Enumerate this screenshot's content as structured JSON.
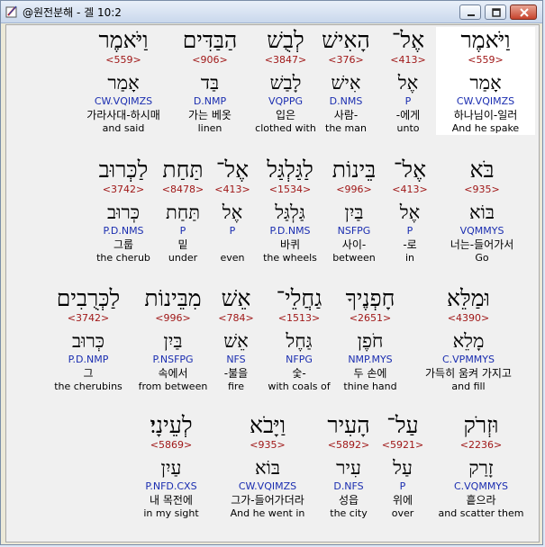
{
  "window": {
    "title": "@원전분해 - 겔 10:2",
    "icon": "bookmark-app-icon"
  },
  "rows": [
    {
      "words": [
        {
          "heb": "וַיֹּאמֶר",
          "strong": "<559>",
          "lex": "אָמַר",
          "morph": "CW.VQIMZS",
          "kor": "하나님이-일러",
          "eng": "And he spake",
          "selected": true
        },
        {
          "heb": "אֶל־",
          "strong": "<413>",
          "lex": "אֶל",
          "morph": "P",
          "kor": "-에게",
          "eng": "unto",
          "selected": false
        },
        {
          "heb": "הָאִישׁ",
          "strong": "<376>",
          "lex": "אִישׁ",
          "morph": "D.NMS",
          "kor": "사람-",
          "eng": "the man",
          "selected": false
        },
        {
          "heb": "לְבֻשׁ",
          "strong": "<3847>",
          "lex": "לָבַשׁ",
          "morph": "VQPPG",
          "kor": "입은",
          "eng": "clothed with",
          "selected": false
        },
        {
          "heb": "הַבַּדִּים",
          "strong": "<906>",
          "lex": "בַּד",
          "morph": "D.NMP",
          "kor": "가는 베옷",
          "eng": "linen",
          "selected": false
        },
        {
          "heb": "וַיֹּאמֶר",
          "strong": "<559>",
          "lex": "אָמַר",
          "morph": "CW.VQIMZS",
          "kor": "가라사대-하시매",
          "eng": "and said",
          "selected": false
        }
      ]
    },
    {
      "words": [
        {
          "heb": "בֹּא",
          "strong": "<935>",
          "lex": "בּוֹא",
          "morph": "VQMMYS",
          "kor": "너는-들어가서",
          "eng": "Go",
          "selected": false
        },
        {
          "heb": "אֶל־",
          "strong": "<413>",
          "lex": "אֶל",
          "morph": "P",
          "kor": "-로",
          "eng": "in",
          "selected": false
        },
        {
          "heb": "בֵּינוֹת",
          "strong": "<996>",
          "lex": "בַּיִן",
          "morph": "NSFPG",
          "kor": "사이-",
          "eng": "between",
          "selected": false
        },
        {
          "heb": "לַגַּלְגַּל",
          "strong": "<1534>",
          "lex": "גַּלְגַּל",
          "morph": "P.D.NMS",
          "kor": "바퀴",
          "eng": "the wheels",
          "selected": false
        },
        {
          "heb": "אֶל־",
          "strong": "<413>",
          "lex": "אֶל",
          "morph": "P",
          "kor": "",
          "eng": "even",
          "selected": false
        },
        {
          "heb": "תַּחַת",
          "strong": "<8478>",
          "lex": "תַּחַת",
          "morph": "P",
          "kor": "밑",
          "eng": "under",
          "selected": false
        },
        {
          "heb": "לַכְּרוּב",
          "strong": "<3742>",
          "lex": "כְּרוּב",
          "morph": "P.D.NMS",
          "kor": "그룹",
          "eng": "the cherub",
          "selected": false
        }
      ]
    },
    {
      "words": [
        {
          "heb": "וּמַלֵּא",
          "strong": "<4390>",
          "lex": "מָלֵא",
          "morph": "C.VPMMYS",
          "kor": "가득히 움켜 가지고",
          "eng": "and fill",
          "selected": false
        },
        {
          "heb": "חָפְנֶיךָ",
          "strong": "<2651>",
          "lex": "חֹפֶן",
          "morph": "NMP.MYS",
          "kor": "두 손에",
          "eng": "thine hand",
          "selected": false
        },
        {
          "heb": "גַחֲלֵי־",
          "strong": "<1513>",
          "lex": "גַּחֶל",
          "morph": "NFPG",
          "kor": "숯-",
          "eng": "with coals of",
          "selected": false
        },
        {
          "heb": "אֵשׁ",
          "strong": "<784>",
          "lex": "אֵשׁ",
          "morph": "NFS",
          "kor": "-불을",
          "eng": "fire",
          "selected": false
        },
        {
          "heb": "מִבֵּינוֹת",
          "strong": "<996>",
          "lex": "בַּיִן",
          "morph": "P.NSFPG",
          "kor": "속에서",
          "eng": "from between",
          "selected": false
        },
        {
          "heb": "לַכְּרֻבִים",
          "strong": "<3742>",
          "lex": "כְּרוּב",
          "morph": "P.D.NMP",
          "kor": "그",
          "eng": "the cherubins",
          "selected": false
        }
      ]
    },
    {
      "words": [
        {
          "heb": "וּזְרֹק",
          "strong": "<2236>",
          "lex": "זָרַק",
          "morph": "C.VQMMYS",
          "kor": "흩으라",
          "eng": "and scatter them",
          "selected": false
        },
        {
          "heb": "עַל־",
          "strong": "<5921>",
          "lex": "עַל",
          "morph": "P",
          "kor": "위에",
          "eng": "over",
          "selected": false
        },
        {
          "heb": "הָעִיר",
          "strong": "<5892>",
          "lex": "עִיר",
          "morph": "D.NFS",
          "kor": "성읍",
          "eng": "the city",
          "selected": false
        },
        {
          "heb": "וַיָּבֹא",
          "strong": "<935>",
          "lex": "בּוֹא",
          "morph": "CW.VQIMZS",
          "kor": "그가-들어가더라",
          "eng": "And he went in",
          "selected": false
        },
        {
          "heb": "לְעֵינָי׃",
          "strong": "<5869>",
          "lex": "עַיִן",
          "morph": "P.NFD.CXS",
          "kor": "내 목전에",
          "eng": "in my sight",
          "selected": false
        }
      ]
    }
  ]
}
